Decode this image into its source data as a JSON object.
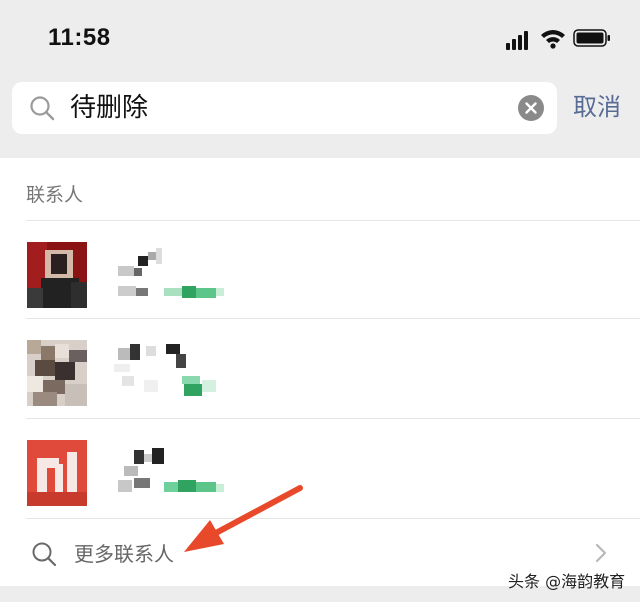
{
  "status_bar": {
    "time": "11:58"
  },
  "search": {
    "query": "待删除",
    "cancel_label": "取消"
  },
  "results": {
    "section_label": "联系人",
    "contacts": [
      {
        "avatar": "contact-avatar",
        "name_pixelated": true
      },
      {
        "avatar": "contact-avatar",
        "name_pixelated": true
      },
      {
        "avatar": "contact-avatar",
        "name_pixelated": true
      }
    ],
    "more_label": "更多联系人"
  },
  "icons": {
    "search": "search-icon",
    "clear": "clear-icon",
    "more": "search-icon",
    "chevron": "chevron-right-icon",
    "annotation": "red-arrow-icon"
  },
  "colors": {
    "accent": "#576b95",
    "annotation": "#e8492a",
    "pixel_green": "#3bb373"
  },
  "watermark": "头条 @海韵教育"
}
